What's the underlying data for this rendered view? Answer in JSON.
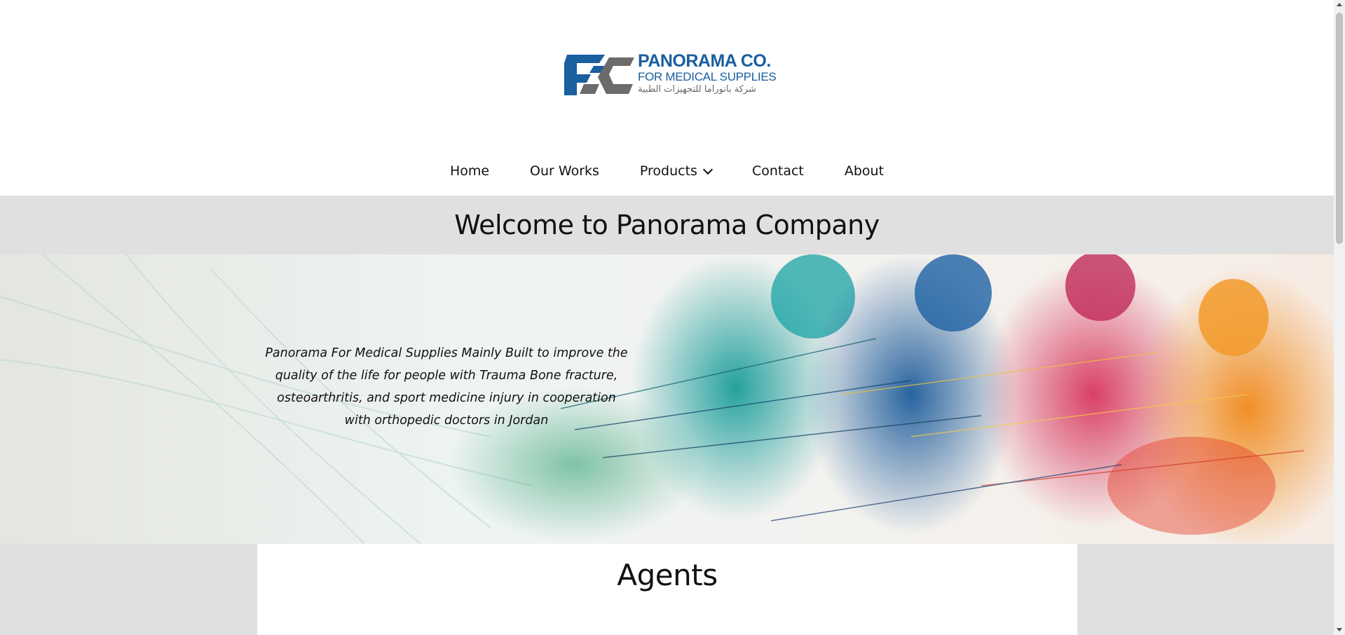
{
  "header": {
    "logo": {
      "line1": "PANORAMA CO.",
      "line2": "FOR MEDICAL SUPPLIES",
      "line3": "شركة بانوراما للتجهيزات الطبية",
      "brand_blue": "#1a5fa0",
      "brand_gray": "#6b6b6b"
    }
  },
  "nav": {
    "items": [
      {
        "label": "Home"
      },
      {
        "label": "Our Works"
      },
      {
        "label": "Products",
        "has_dropdown": true,
        "icon": "chevron-down-icon"
      },
      {
        "label": "Contact"
      },
      {
        "label": "About"
      }
    ]
  },
  "welcome": {
    "title": "Welcome to Panorama Company",
    "background": "#e0e0e0"
  },
  "hero": {
    "description": "Panorama For Medical Supplies Mainly Built to improve the quality of the life for people with Trauma Bone fracture, osteoarthritis, and sport medicine injury in cooperation with orthopedic doctors in Jordan",
    "image_subject": "colorful runners splash artwork"
  },
  "agents": {
    "title": "Agents"
  }
}
